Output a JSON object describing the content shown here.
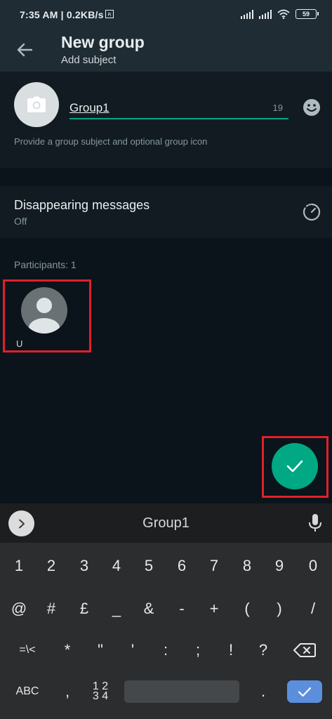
{
  "status_bar": {
    "time": "7:35 AM | 0.2KB/s",
    "battery": "59",
    "icons": [
      "voice-over-lte-icon",
      "signal-icon",
      "signal-icon",
      "wifi-icon",
      "battery-icon"
    ]
  },
  "header": {
    "title": "New group",
    "subtitle": "Add subject",
    "back_icon": "arrow-back-icon"
  },
  "subject": {
    "value": "Group1",
    "chars_remaining": "19",
    "hint": "Provide a group subject and optional group icon",
    "icons": [
      "camera-icon",
      "emoji-icon"
    ]
  },
  "disappearing": {
    "title": "Disappearing messages",
    "value": "Off",
    "icon": "timer-icon"
  },
  "participants": {
    "label": "Participants: 1",
    "items": [
      {
        "name": "U"
      }
    ]
  },
  "fab_icon": "check-icon",
  "keyboard": {
    "suggestion": "Group1",
    "row1": [
      "1",
      "2",
      "3",
      "4",
      "5",
      "6",
      "7",
      "8",
      "9",
      "0"
    ],
    "row2": [
      "@",
      "#",
      "£",
      "_",
      "&",
      "-",
      "+",
      "(",
      ")",
      "/"
    ],
    "row3": [
      "=\\<",
      "*",
      "\"",
      "'",
      ":",
      ";",
      "!",
      "?"
    ],
    "row4": {
      "abc": "ABC",
      "comma": ",",
      "num": "1 2\n3 4",
      "period": "."
    },
    "accent_color": "#5b8fde"
  },
  "colors": {
    "accent": "#00a884",
    "highlight_box": "#e0202c",
    "background": "#0b141a",
    "card": "#111b21"
  }
}
